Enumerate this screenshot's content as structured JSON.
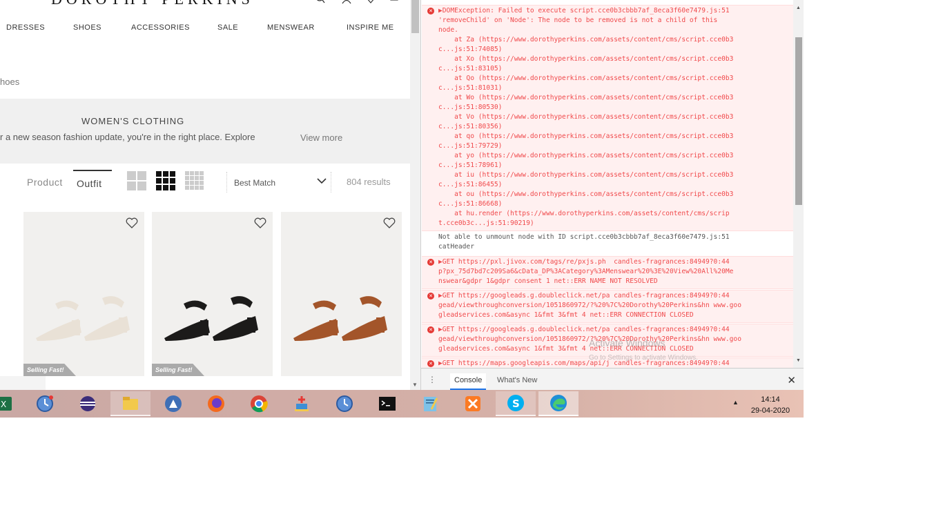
{
  "site": {
    "logo": "DOROTHY PERKINS",
    "nav": [
      "DRESSES",
      "SHOES",
      "ACCESSORIES",
      "SALE",
      "MENSWEAR",
      "INSPIRE ME"
    ],
    "breadcrumb": "hoes",
    "banner": {
      "title": "WOMEN'S CLOTHING",
      "text": "r a new season fashion update, you're in the right place. Explore",
      "more": "View more"
    },
    "toolbar": {
      "product_label": "Product",
      "outfit_label": "Outfit",
      "sort_value": "Best Match",
      "results": "804 results"
    },
    "products": [
      {
        "badge": "Selling Fast!",
        "color": "#e9e1d6"
      },
      {
        "badge": "Selling Fast!",
        "color": "#1c1b1a"
      },
      {
        "badge": "",
        "color": "#a3552a"
      }
    ]
  },
  "console": {
    "messages": [
      {
        "type": "error",
        "lines": [
          "▶DOMException: Failed to execute script.cce0b3cbbb7af_8eca3f60e7479.js:51",
          "'removeChild' on 'Node': The node to be removed is not a child of this",
          "node.",
          "    at Za (https://www.dorothyperkins.com/assets/content/cms/script.cce0b3",
          "c...js:51:74085)",
          "    at Xo (https://www.dorothyperkins.com/assets/content/cms/script.cce0b3",
          "c...js:51:83105)",
          "    at Qo (https://www.dorothyperkins.com/assets/content/cms/script.cce0b3",
          "c...js:51:81031)",
          "    at Wo (https://www.dorothyperkins.com/assets/content/cms/script.cce0b3",
          "c...js:51:80530)",
          "    at Vo (https://www.dorothyperkins.com/assets/content/cms/script.cce0b3",
          "c...js:51:80356)",
          "    at qo (https://www.dorothyperkins.com/assets/content/cms/script.cce0b3",
          "c...js:51:79729)",
          "    at yo (https://www.dorothyperkins.com/assets/content/cms/script.cce0b3",
          "c...js:51:78961)",
          "    at iu (https://www.dorothyperkins.com/assets/content/cms/script.cce0b3",
          "c...js:51:86455)",
          "    at ou (https://www.dorothyperkins.com/assets/content/cms/script.cce0b3",
          "c...js:51:86668)",
          "    at hu.render (https://www.dorothyperkins.com/assets/content/cms/scrip",
          "t.cce0b3c...js:51:90219)"
        ]
      },
      {
        "type": "log",
        "lines": [
          "Not able to unmount node with ID script.cce0b3cbbb7af_8eca3f60e7479.js:51",
          "catHeader"
        ]
      },
      {
        "type": "error",
        "lines": [
          "▶GET https://pxl.jivox.com/tags/re/pxjs.ph  candles-fragrances:84949?0:44",
          "p?px_75d7bd7c209Sa6&cData_DP%3ACategory%3AMenswear%20%3E%20View%20All%20Me",
          "nswear&gdpr 1&gdpr consent 1 net::ERR NAME NOT RESOLVED"
        ]
      },
      {
        "type": "error",
        "lines": [
          "▶GET https://googleads.g.doubleclick.net/pa candles-fragrances:84949?0:44",
          "gead/viewthroughconversion/1051860972/?%20%7C%20Dorothy%20Perkins&hn www.goo",
          "gleadservices.com&async 1&fmt 3&fmt 4 net::ERR CONNECTION CLOSED"
        ]
      },
      {
        "type": "error",
        "lines": [
          "▶GET https://googleads.g.doubleclick.net/pa candles-fragrances:84949?0:44",
          "gead/viewthroughconversion/1051860972/?%20%7C%20Dorothy%20Perkins&hn www.goo",
          "gleadservices.com&async 1&fmt 3&fmt 4 net::ERR CONNECTION CLOSED"
        ]
      },
      {
        "type": "error",
        "lines": [
          "▶GET https://maps.googleapis.com/maps/api/j candles-fragrances:84949?0:44"
        ]
      }
    ],
    "watermark": "Activate Windows",
    "watermark_sub": "Go to Settings to activate Windows.",
    "drawer_tabs": [
      "Console",
      "What's New"
    ],
    "drawer_dots": "⋮",
    "close_glyph": "✕"
  },
  "taskbar": {
    "apps": [
      {
        "name": "excel-icon",
        "state": ""
      },
      {
        "name": "clock-app-icon",
        "state": ""
      },
      {
        "name": "eclipse-icon",
        "state": ""
      },
      {
        "name": "file-explorer-icon",
        "state": "open"
      },
      {
        "name": "app-a-icon",
        "state": ""
      },
      {
        "name": "firefox-icon",
        "state": ""
      },
      {
        "name": "chrome-icon",
        "state": ""
      },
      {
        "name": "virtual-device-icon",
        "state": ""
      },
      {
        "name": "clock-app-2-icon",
        "state": ""
      },
      {
        "name": "terminal-icon",
        "state": ""
      },
      {
        "name": "notepad-icon",
        "state": ""
      },
      {
        "name": "xampp-icon",
        "state": ""
      },
      {
        "name": "skype-icon",
        "state": "open"
      },
      {
        "name": "edge-icon",
        "state": "active"
      }
    ],
    "time": "14:14",
    "date": "29-04-2020",
    "tray_chevron": "▲"
  }
}
